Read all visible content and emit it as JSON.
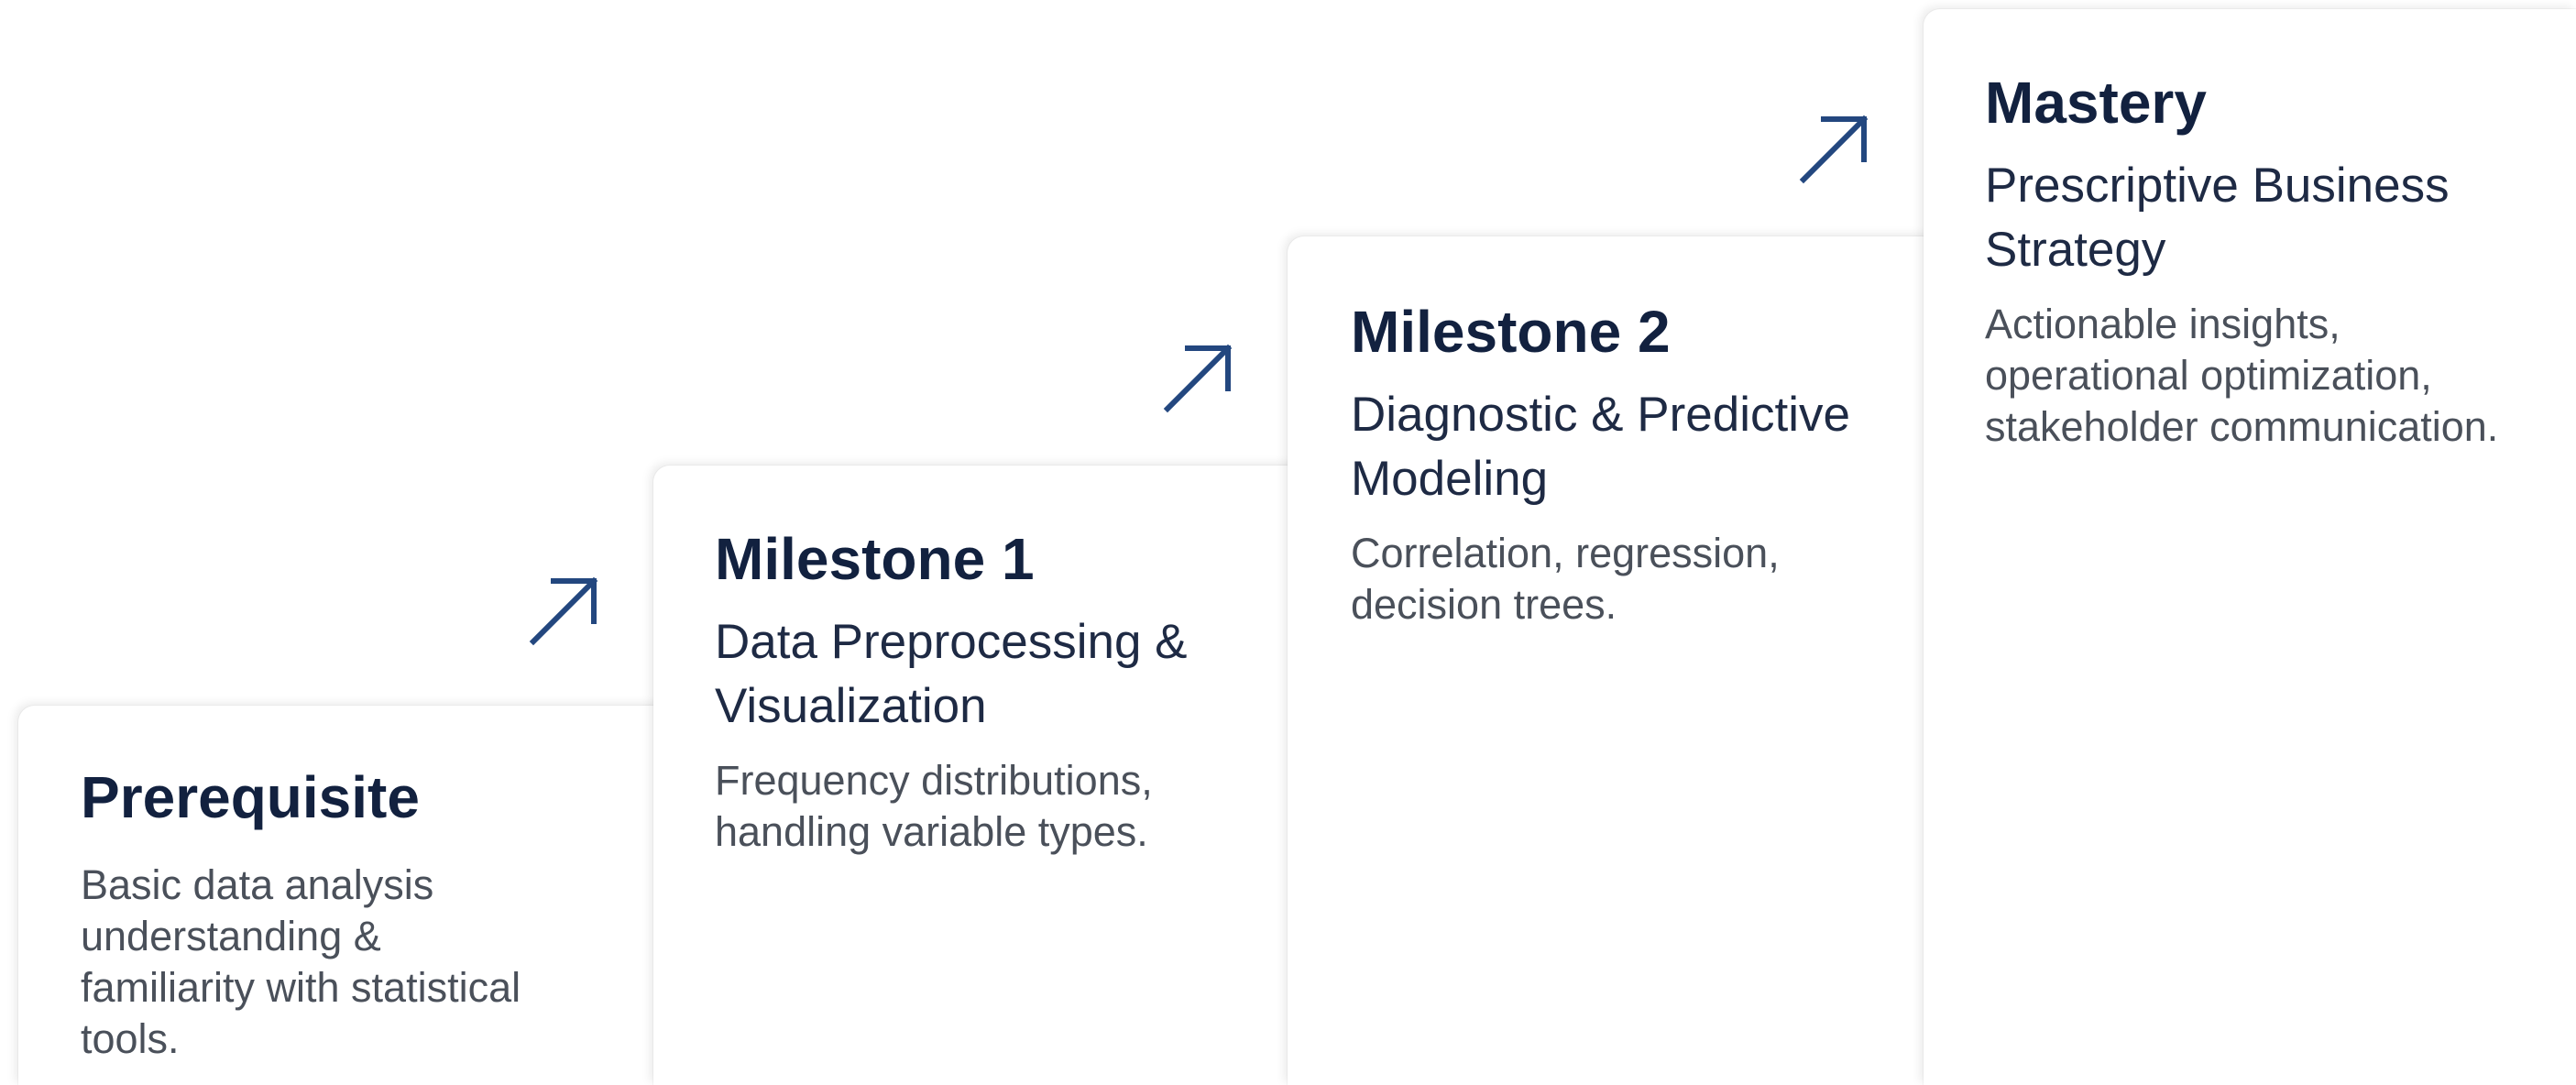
{
  "steps": [
    {
      "title": "Prerequisite",
      "subtitle": "",
      "description": "Basic data analysis understanding & familiarity with statistical tools."
    },
    {
      "title": "Milestone 1",
      "subtitle": "Data Preprocessing & Visualization",
      "description": "Frequency distributions, handling variable types."
    },
    {
      "title": "Milestone 2",
      "subtitle": "Diagnostic & Predictive Modeling",
      "description": "Correlation, regression, decision trees."
    },
    {
      "title": "Mastery",
      "subtitle": "Prescriptive Business Strategy",
      "description": "Actionable insights, operational optimization, stakeholder communication."
    }
  ],
  "arrow_icon": "arrow-up-right-icon",
  "colors": {
    "title": "#12213f",
    "subtitle": "#1e2a44",
    "description": "#4a505a",
    "arrow": "#23477f",
    "background": "#ffffff"
  }
}
